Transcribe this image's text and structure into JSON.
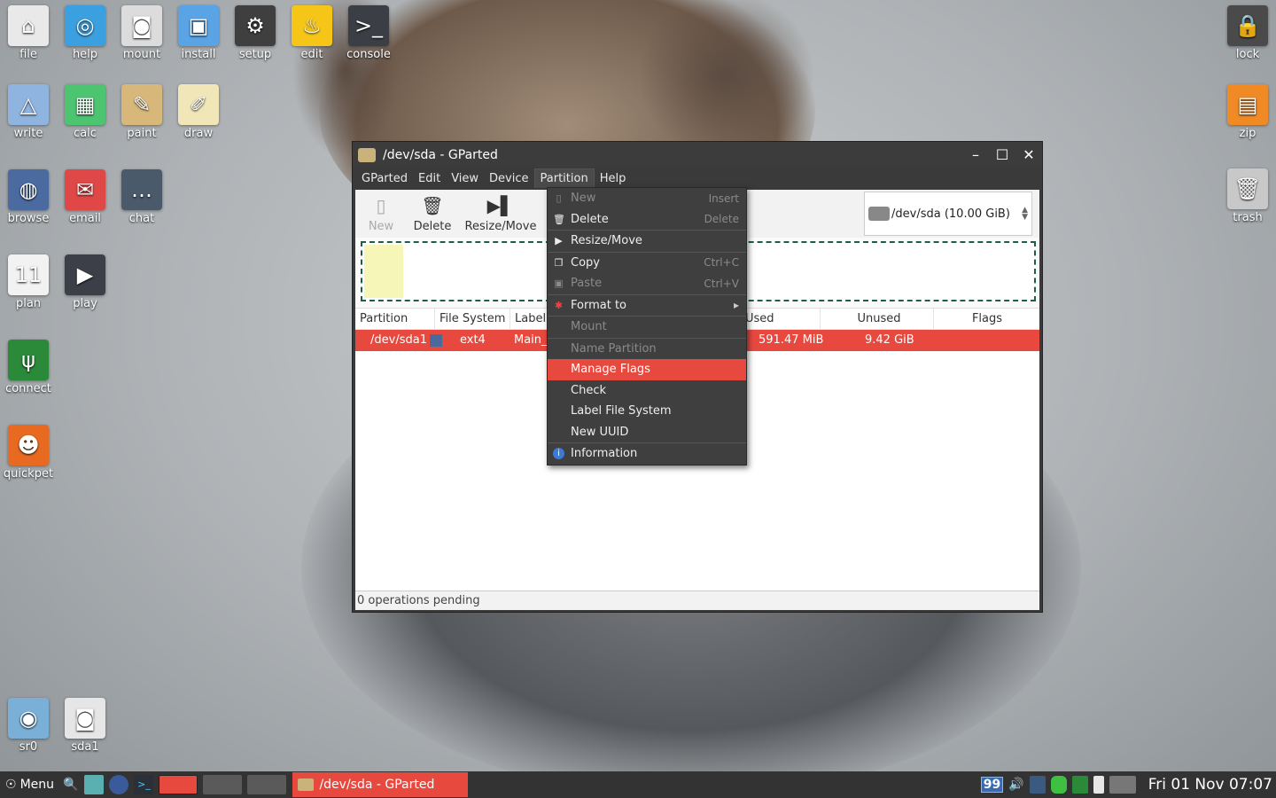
{
  "desktop": {
    "icons_left": [
      {
        "label": "file",
        "icon": "home-icon",
        "color": "#e9e9e9",
        "glyph": "⌂"
      },
      {
        "label": "help",
        "icon": "lifebuoy-icon",
        "color": "#3aa0e0",
        "glyph": "◎"
      },
      {
        "label": "mount",
        "icon": "drive-icon",
        "color": "#dcdcdc",
        "glyph": "◙"
      },
      {
        "label": "install",
        "icon": "package-icon",
        "color": "#5aa4e6",
        "glyph": "▣"
      },
      {
        "label": "setup",
        "icon": "gear-icon",
        "color": "#3f3f3f",
        "glyph": "⚙"
      },
      {
        "label": "edit",
        "icon": "lamp-icon",
        "color": "#f5c518",
        "glyph": "♨"
      },
      {
        "label": "console",
        "icon": "terminal-icon",
        "color": "#3b3f45",
        "glyph": ">_"
      },
      {
        "label": "write",
        "icon": "write-icon",
        "color": "#8fb4e0",
        "glyph": "△"
      },
      {
        "label": "calc",
        "icon": "spreadsheet-icon",
        "color": "#4cc470",
        "glyph": "▦"
      },
      {
        "label": "paint",
        "icon": "paint-icon",
        "color": "#d8b87a",
        "glyph": "✎"
      },
      {
        "label": "draw",
        "icon": "draw-icon",
        "color": "#f0e6b8",
        "glyph": "✐"
      },
      {
        "label": "browse",
        "icon": "globe-icon",
        "color": "#4a6aa0",
        "glyph": "◍"
      },
      {
        "label": "email",
        "icon": "envelope-icon",
        "color": "#e04848",
        "glyph": "✉"
      },
      {
        "label": "chat",
        "icon": "chat-icon",
        "color": "#4a5a6a",
        "glyph": "…"
      },
      {
        "label": "plan",
        "icon": "calendar-icon",
        "color": "#f2f2f2",
        "glyph": "11"
      },
      {
        "label": "play",
        "icon": "play-icon",
        "color": "#3c3f48",
        "glyph": "▶"
      },
      {
        "label": "connect",
        "icon": "antenna-icon",
        "color": "#2a8a3a",
        "glyph": "ψ"
      },
      {
        "label": "quickpet",
        "icon": "quickpet-icon",
        "color": "#e86a20",
        "glyph": "☻"
      },
      {
        "label": "sr0",
        "icon": "cdrom-icon",
        "color": "#7ab0d8",
        "glyph": "◉"
      },
      {
        "label": "sda1",
        "icon": "drive-icon",
        "color": "#e6e6e6",
        "glyph": "◙"
      }
    ],
    "icons_right": [
      {
        "label": "lock",
        "icon": "lock-icon",
        "color": "#4a4a4a",
        "glyph": "🔒"
      },
      {
        "label": "zip",
        "icon": "archive-icon",
        "color": "#f08a24",
        "glyph": "▤"
      },
      {
        "label": "trash",
        "icon": "trash-icon",
        "color": "#c8c8c8",
        "glyph": "🗑"
      }
    ]
  },
  "window": {
    "title": "/dev/sda - GParted",
    "menu": [
      "GParted",
      "Edit",
      "View",
      "Device",
      "Partition",
      "Help"
    ],
    "toolbar": {
      "new_label": "New",
      "delete_label": "Delete",
      "resize_label": "Resize/Move"
    },
    "device_selector": "/dev/sda   (10.00 GiB)",
    "columns": {
      "partition": "Partition",
      "filesystem": "File System",
      "label": "Label",
      "used": "Used",
      "unused": "Unused",
      "flags": "Flags"
    },
    "row": {
      "partition": "/dev/sda1",
      "filesystem": "ext4",
      "label": "Main_",
      "used": "591.47 MiB",
      "unused": "9.42 GiB",
      "fs_color": "#4a6a9a"
    },
    "status": "0 operations pending"
  },
  "partition_menu": {
    "items": [
      {
        "label": "New",
        "accel": "Insert"
      },
      {
        "label": "Delete",
        "accel": "Delete"
      },
      {
        "label": "Resize/Move",
        "accel": ""
      },
      {
        "label": "Copy",
        "accel": "Ctrl+C"
      },
      {
        "label": "Paste",
        "accel": "Ctrl+V"
      },
      {
        "label": "Format to",
        "accel": ""
      },
      {
        "label": "Mount",
        "accel": ""
      },
      {
        "label": "Name Partition",
        "accel": ""
      },
      {
        "label": "Manage Flags",
        "accel": ""
      },
      {
        "label": "Check",
        "accel": ""
      },
      {
        "label": "Label File System",
        "accel": ""
      },
      {
        "label": "New UUID",
        "accel": ""
      },
      {
        "label": "Information",
        "accel": ""
      }
    ]
  },
  "taskbar": {
    "menu_label": "Menu",
    "task_label": "/dev/sda - GParted",
    "tray_badge": "99",
    "clock": "Fri 01 Nov 07:07"
  },
  "colors": {
    "accent": "#e8493f",
    "menu_bg": "#3f3f3f",
    "taskbar_bg": "#333333"
  }
}
